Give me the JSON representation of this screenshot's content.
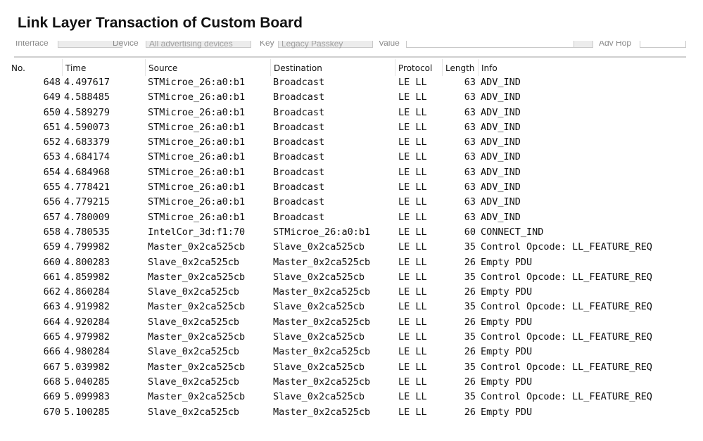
{
  "title": "Link Layer Transaction of Custom Board",
  "toolbar": {
    "interface_label": "Interface",
    "device_label": "Device",
    "device_value": "All advertising devices",
    "key_label": "Key",
    "key_value": "Legacy Passkey",
    "value_label": "Value",
    "adv_hop_label": "Adv Hop"
  },
  "columns": {
    "no": "No.",
    "time": "Time",
    "source": "Source",
    "destination": "Destination",
    "protocol": "Protocol",
    "length": "Length",
    "info": "Info"
  },
  "packets": [
    {
      "no": "648",
      "time": "4.497617",
      "source": "STMicroe_26:a0:b1",
      "destination": "Broadcast",
      "protocol": "LE LL",
      "length": "63",
      "info": "ADV_IND"
    },
    {
      "no": "649",
      "time": "4.588485",
      "source": "STMicroe_26:a0:b1",
      "destination": "Broadcast",
      "protocol": "LE LL",
      "length": "63",
      "info": "ADV_IND"
    },
    {
      "no": "650",
      "time": "4.589279",
      "source": "STMicroe_26:a0:b1",
      "destination": "Broadcast",
      "protocol": "LE LL",
      "length": "63",
      "info": "ADV_IND"
    },
    {
      "no": "651",
      "time": "4.590073",
      "source": "STMicroe_26:a0:b1",
      "destination": "Broadcast",
      "protocol": "LE LL",
      "length": "63",
      "info": "ADV_IND"
    },
    {
      "no": "652",
      "time": "4.683379",
      "source": "STMicroe_26:a0:b1",
      "destination": "Broadcast",
      "protocol": "LE LL",
      "length": "63",
      "info": "ADV_IND"
    },
    {
      "no": "653",
      "time": "4.684174",
      "source": "STMicroe_26:a0:b1",
      "destination": "Broadcast",
      "protocol": "LE LL",
      "length": "63",
      "info": "ADV_IND"
    },
    {
      "no": "654",
      "time": "4.684968",
      "source": "STMicroe_26:a0:b1",
      "destination": "Broadcast",
      "protocol": "LE LL",
      "length": "63",
      "info": "ADV_IND"
    },
    {
      "no": "655",
      "time": "4.778421",
      "source": "STMicroe_26:a0:b1",
      "destination": "Broadcast",
      "protocol": "LE LL",
      "length": "63",
      "info": "ADV_IND"
    },
    {
      "no": "656",
      "time": "4.779215",
      "source": "STMicroe_26:a0:b1",
      "destination": "Broadcast",
      "protocol": "LE LL",
      "length": "63",
      "info": "ADV_IND"
    },
    {
      "no": "657",
      "time": "4.780009",
      "source": "STMicroe_26:a0:b1",
      "destination": "Broadcast",
      "protocol": "LE LL",
      "length": "63",
      "info": "ADV_IND"
    },
    {
      "no": "658",
      "time": "4.780535",
      "source": "IntelCor_3d:f1:70",
      "destination": "STMicroe_26:a0:b1",
      "protocol": "LE LL",
      "length": "60",
      "info": "CONNECT_IND"
    },
    {
      "no": "659",
      "time": "4.799982",
      "source": "Master_0x2ca525cb",
      "destination": "Slave_0x2ca525cb",
      "protocol": "LE LL",
      "length": "35",
      "info": "Control Opcode: LL_FEATURE_REQ"
    },
    {
      "no": "660",
      "time": "4.800283",
      "source": "Slave_0x2ca525cb",
      "destination": "Master_0x2ca525cb",
      "protocol": "LE LL",
      "length": "26",
      "info": "Empty PDU"
    },
    {
      "no": "661",
      "time": "4.859982",
      "source": "Master_0x2ca525cb",
      "destination": "Slave_0x2ca525cb",
      "protocol": "LE LL",
      "length": "35",
      "info": "Control Opcode: LL_FEATURE_REQ"
    },
    {
      "no": "662",
      "time": "4.860284",
      "source": "Slave_0x2ca525cb",
      "destination": "Master_0x2ca525cb",
      "protocol": "LE LL",
      "length": "26",
      "info": "Empty PDU"
    },
    {
      "no": "663",
      "time": "4.919982",
      "source": "Master_0x2ca525cb",
      "destination": "Slave_0x2ca525cb",
      "protocol": "LE LL",
      "length": "35",
      "info": "Control Opcode: LL_FEATURE_REQ"
    },
    {
      "no": "664",
      "time": "4.920284",
      "source": "Slave_0x2ca525cb",
      "destination": "Master_0x2ca525cb",
      "protocol": "LE LL",
      "length": "26",
      "info": "Empty PDU"
    },
    {
      "no": "665",
      "time": "4.979982",
      "source": "Master_0x2ca525cb",
      "destination": "Slave_0x2ca525cb",
      "protocol": "LE LL",
      "length": "35",
      "info": "Control Opcode: LL_FEATURE_REQ"
    },
    {
      "no": "666",
      "time": "4.980284",
      "source": "Slave_0x2ca525cb",
      "destination": "Master_0x2ca525cb",
      "protocol": "LE LL",
      "length": "26",
      "info": "Empty PDU"
    },
    {
      "no": "667",
      "time": "5.039982",
      "source": "Master_0x2ca525cb",
      "destination": "Slave_0x2ca525cb",
      "protocol": "LE LL",
      "length": "35",
      "info": "Control Opcode: LL_FEATURE_REQ"
    },
    {
      "no": "668",
      "time": "5.040285",
      "source": "Slave_0x2ca525cb",
      "destination": "Master_0x2ca525cb",
      "protocol": "LE LL",
      "length": "26",
      "info": "Empty PDU"
    },
    {
      "no": "669",
      "time": "5.099983",
      "source": "Master_0x2ca525cb",
      "destination": "Slave_0x2ca525cb",
      "protocol": "LE LL",
      "length": "35",
      "info": "Control Opcode: LL_FEATURE_REQ"
    },
    {
      "no": "670",
      "time": "5.100285",
      "source": "Slave_0x2ca525cb",
      "destination": "Master_0x2ca525cb",
      "protocol": "LE LL",
      "length": "26",
      "info": "Empty PDU"
    }
  ]
}
